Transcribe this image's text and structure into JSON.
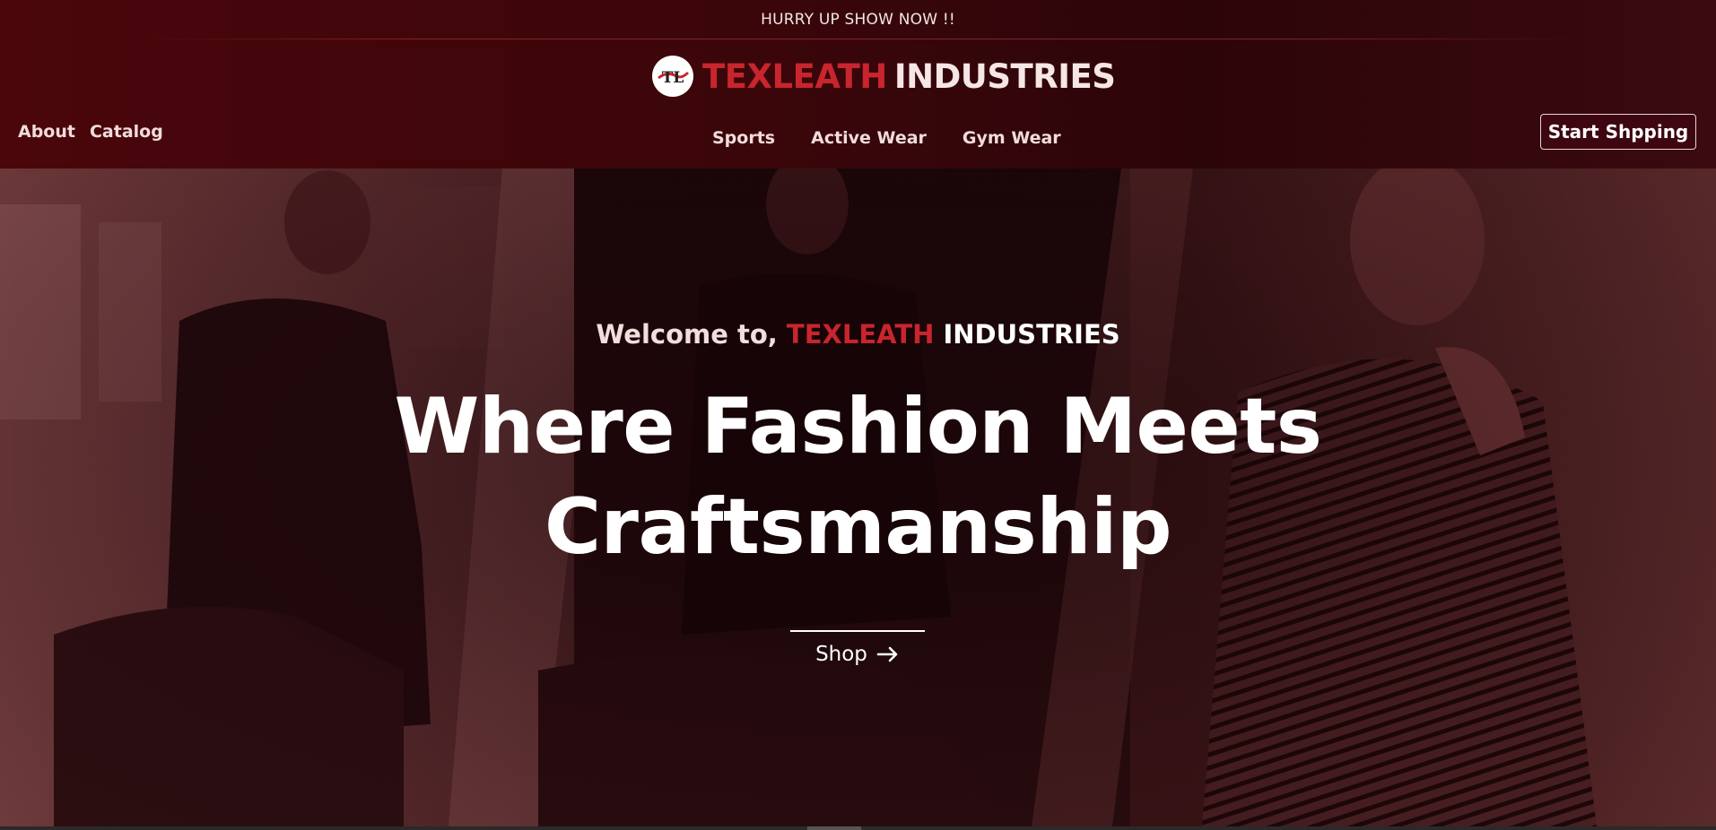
{
  "announcement": "HURRY UP SHOW NOW !!",
  "brand": {
    "name_red": "TEXLEATH",
    "name_white": "INDUSTRIES",
    "logo_text": "TL",
    "accent_color": "#c8252d"
  },
  "nav_left": [
    "About",
    "Catalog"
  ],
  "nav_center": [
    "Sports",
    "Active Wear",
    "Gym Wear"
  ],
  "cta_button": "Start Shpping",
  "hero": {
    "welcome_prefix": "Welcome to,",
    "welcome_red": "TEXLEATH",
    "welcome_white": "INDUSTRIES",
    "headline_line1": "Where Fashion Meets",
    "headline_line2": "Craftsmanship",
    "shop_label": "Shop",
    "shop_icon": "arrow-right-icon",
    "background": "three-men-fashion-photo-red-tint"
  },
  "colors": {
    "header_bg": "#3e060b",
    "hero_tint": "#5a1c20"
  }
}
